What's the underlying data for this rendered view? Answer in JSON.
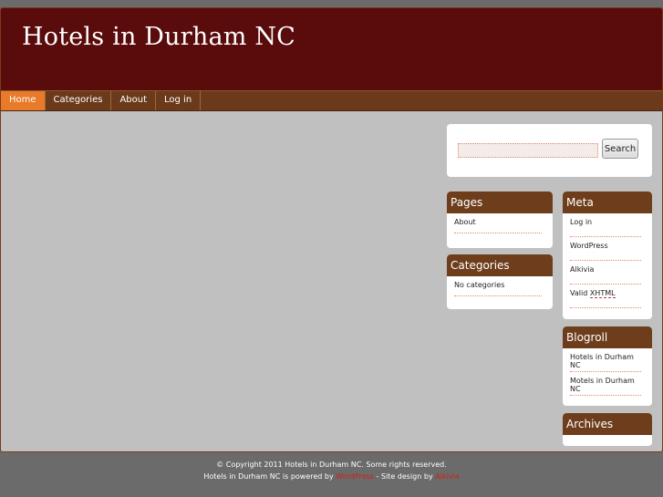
{
  "site": {
    "title": "Hotels in Durham NC"
  },
  "nav": {
    "items": [
      "Home",
      "Categories",
      "About",
      "Log in"
    ]
  },
  "search": {
    "placeholder": "",
    "button_label": "Search"
  },
  "widgets": {
    "pages": {
      "title": "Pages",
      "items": [
        "About"
      ]
    },
    "categories": {
      "title": "Categories",
      "items": [
        "No categories"
      ]
    },
    "meta": {
      "title": "Meta",
      "items": [
        "Log in",
        "WordPress",
        "Alkivia"
      ],
      "valid_prefix": "Valid",
      "valid_link": "XHTML"
    },
    "blogroll": {
      "title": "Blogroll",
      "items": [
        "Hotels in Durham NC",
        "Motels in Durham NC"
      ]
    },
    "archives": {
      "title": "Archives"
    }
  },
  "footer": {
    "line1": "© Copyright 2011 Hotels in Durham NC. Some rights reserved.",
    "line2_prefix": "Hotels in Durham NC is powered by",
    "line2_link1": "WordPress",
    "line2_middle": "- Site design by",
    "line2_link2": "Alkivia"
  },
  "colors": {
    "header_bg": "#5a0b0b",
    "nav_bg": "#6b3a1a",
    "nav_active": "#e87a2a",
    "widget_title_bg": "#6e3e1c",
    "link_red": "#d0201a"
  }
}
